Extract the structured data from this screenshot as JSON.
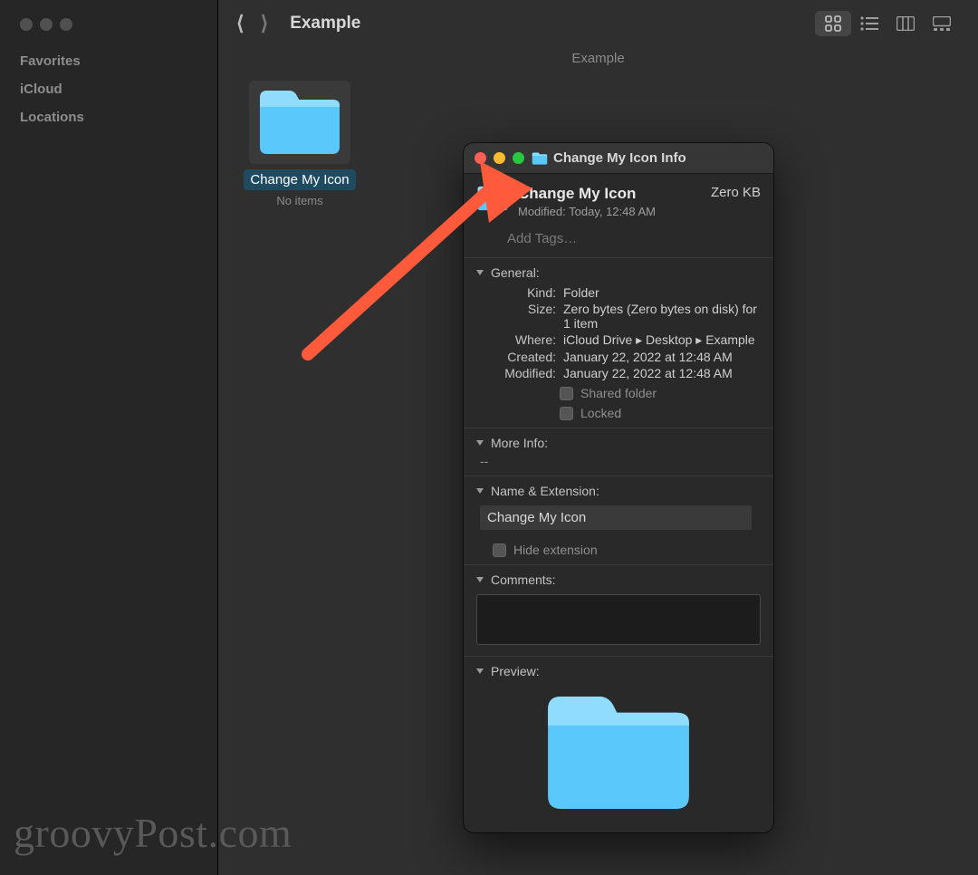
{
  "sidebar": {
    "sections": [
      "Favorites",
      "iCloud",
      "Locations"
    ]
  },
  "toolbar": {
    "title": "Example",
    "breadcrumb": "Example"
  },
  "item": {
    "name": "Change My Icon",
    "subtitle": "No items"
  },
  "info": {
    "window_title": "Change My Icon Info",
    "name": "Change My Icon",
    "modified_line": "Modified: Today, 12:48 AM",
    "size_badge": "Zero KB",
    "tags_placeholder": "Add Tags…",
    "general": {
      "title": "General:",
      "kind_label": "Kind:",
      "kind": "Folder",
      "size_label": "Size:",
      "size": "Zero bytes (Zero bytes on disk) for 1 item",
      "where_label": "Where:",
      "where": "iCloud Drive ▸ Desktop ▸ Example",
      "created_label": "Created:",
      "created": "January 22, 2022 at 12:48 AM",
      "modified_label": "Modified:",
      "modified": "January 22, 2022 at 12:48 AM",
      "shared_label": "Shared folder",
      "locked_label": "Locked"
    },
    "moreinfo": {
      "title": "More Info:",
      "value": "--"
    },
    "name_ext": {
      "title": "Name & Extension:",
      "value": "Change My Icon",
      "hide_label": "Hide extension"
    },
    "comments": {
      "title": "Comments:"
    },
    "preview": {
      "title": "Preview:"
    }
  },
  "watermark": "groovyPost.com"
}
